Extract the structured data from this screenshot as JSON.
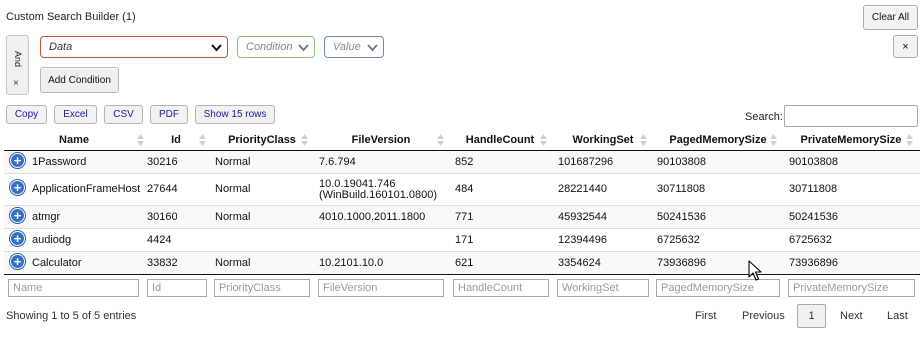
{
  "builder": {
    "title": "Custom Search Builder (1)",
    "clear_all": "Clear All",
    "logic": "And",
    "logic_remove": "×",
    "data_select": "Data",
    "condition_select": "Condition",
    "value_select": "Value",
    "add_condition": "Add Condition",
    "remove_criteria": "×"
  },
  "export_buttons": [
    "Copy",
    "Excel",
    "CSV",
    "PDF",
    "Show 15 rows"
  ],
  "search": {
    "label": "Search:",
    "value": ""
  },
  "columns": [
    "Name",
    "Id",
    "PriorityClass",
    "FileVersion",
    "HandleCount",
    "WorkingSet",
    "PagedMemorySize",
    "PrivateMemorySize"
  ],
  "rows": [
    {
      "expand": "+",
      "name": "1Password",
      "id": "30216",
      "priority": "Normal",
      "version": "7.6.794",
      "version2": "",
      "handles": "852",
      "working": "101687296",
      "paged": "90103808",
      "private": "90103808"
    },
    {
      "expand": "+",
      "name": "ApplicationFrameHost",
      "id": "27644",
      "priority": "Normal",
      "version": "10.0.19041.746",
      "version2": "(WinBuild.160101.0800)",
      "handles": "484",
      "working": "28221440",
      "paged": "30711808",
      "private": "30711808"
    },
    {
      "expand": "+",
      "name": "atmgr",
      "id": "30160",
      "priority": "Normal",
      "version": "4010.1000.2011.1800",
      "version2": "",
      "handles": "771",
      "working": "45932544",
      "paged": "50241536",
      "private": "50241536"
    },
    {
      "expand": "+",
      "name": "audiodg",
      "id": "4424",
      "priority": "",
      "version": "",
      "version2": "",
      "handles": "171",
      "working": "12394496",
      "paged": "6725632",
      "private": "6725632"
    },
    {
      "expand": "+",
      "name": "Calculator",
      "id": "33832",
      "priority": "Normal",
      "version": "10.2101.10.0",
      "version2": "",
      "handles": "621",
      "working": "3354624",
      "paged": "73936896",
      "private": "73936896"
    }
  ],
  "footer_filters": [
    "Name",
    "Id",
    "PriorityClass",
    "FileVersion",
    "HandleCount",
    "WorkingSet",
    "PagedMemorySize",
    "PrivateMemorySize"
  ],
  "info": "Showing 1 to 5 of 5 entries",
  "pagination": {
    "first": "First",
    "previous": "Previous",
    "current": "1",
    "next": "Next",
    "last": "Last"
  },
  "colors": {
    "accent_blue": "#3470c4",
    "data_border": "#c0543a",
    "condition_border": "#8fbf73",
    "value_border": "#6b86c2"
  }
}
